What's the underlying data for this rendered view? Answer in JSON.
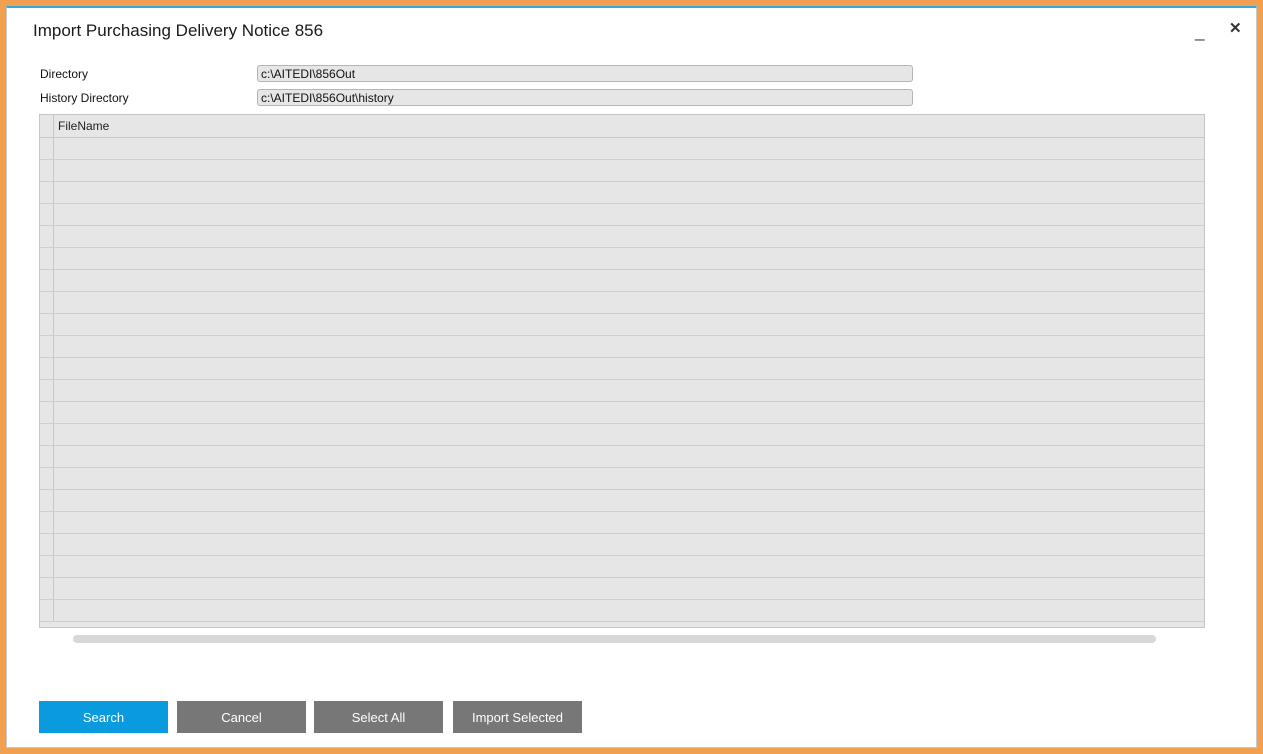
{
  "window": {
    "title": "Import Purchasing Delivery Notice 856",
    "minimize_label": "_",
    "close_label": "✕"
  },
  "fields": {
    "directory": {
      "label": "Directory",
      "value": "c:\\AITEDI\\856Out"
    },
    "history_directory": {
      "label": "History Directory",
      "value": "c:\\AITEDI\\856Out\\history"
    }
  },
  "grid": {
    "columns": [
      "FileName"
    ],
    "rows": []
  },
  "buttons": {
    "search": "Search",
    "cancel": "Cancel",
    "select_all": "Select All",
    "import_selected": "Import Selected"
  },
  "colors": {
    "frame": "#f0a050",
    "accent": "#0a9bdf",
    "button_secondary": "#777777",
    "grid_background": "#e6e6e6"
  }
}
